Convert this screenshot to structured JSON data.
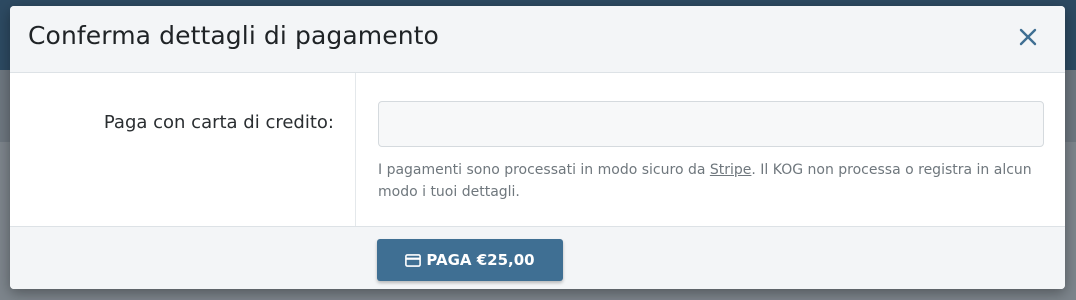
{
  "colors": {
    "header_bg": "#f3f5f7",
    "button_bg": "#3f6f93",
    "close_icon": "#3f6f93",
    "backdrop": "#6b7782"
  },
  "modal": {
    "title": "Conferma dettagli di pagamento",
    "close_icon": "close-icon"
  },
  "form": {
    "card_label": "Paga con carta di credito:",
    "card_input_value": "",
    "help_prefix": "I pagamenti sono processati in modo sicuro da ",
    "help_link": "Stripe",
    "help_suffix": ". Il KOG non processa o registra in alcun modo i tuoi dettagli."
  },
  "footer": {
    "pay_button_label": "PAGA €25,00",
    "pay_button_icon": "credit-card-icon"
  }
}
